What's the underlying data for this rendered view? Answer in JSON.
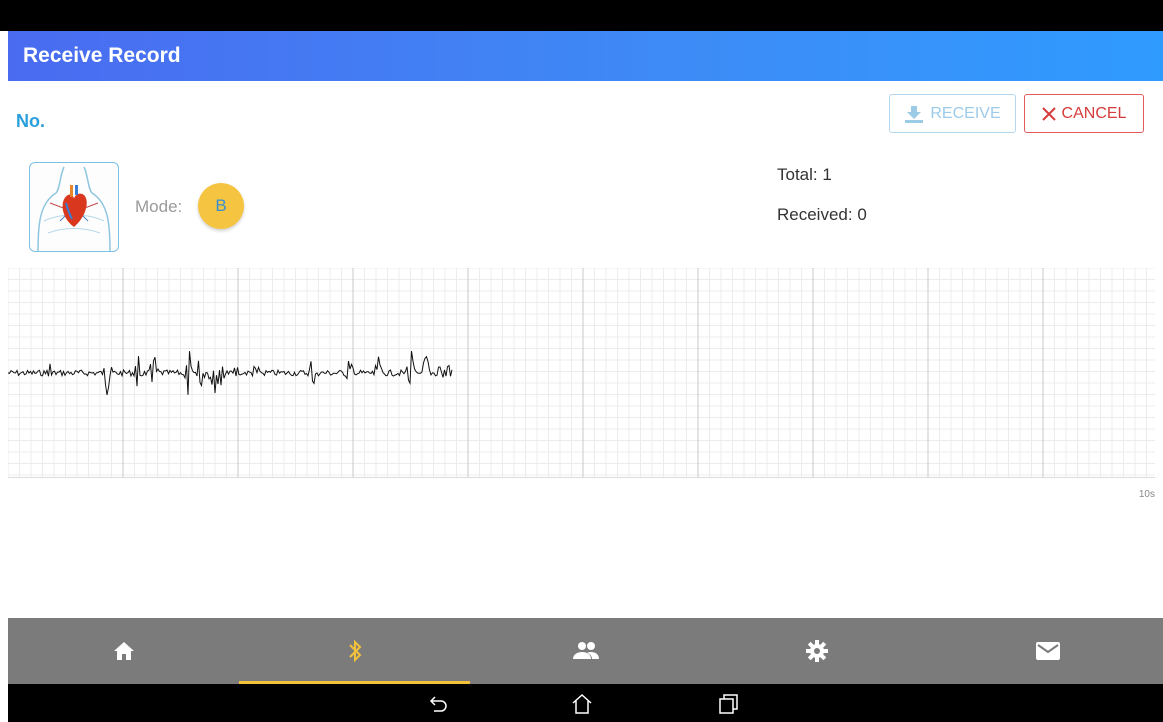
{
  "app_bar": {
    "title": "Receive Record"
  },
  "record": {
    "number_label": "No."
  },
  "actions": {
    "receive_label": "RECEIVE",
    "cancel_label": "CANCEL"
  },
  "info": {
    "mode_label": "Mode:",
    "mode_value": "B",
    "total": "Total: 1",
    "received": "Received: 0"
  },
  "chart": {
    "time_label": "10s"
  },
  "bottom_nav": {
    "items": [
      {
        "icon": "home-icon",
        "active": false
      },
      {
        "icon": "bluetooth-icon",
        "active": true
      },
      {
        "icon": "people-icon",
        "active": false
      },
      {
        "icon": "gear-icon",
        "active": false
      },
      {
        "icon": "mail-icon",
        "active": false
      }
    ]
  },
  "system_nav": {
    "icons": [
      "back-icon",
      "home-outline-icon",
      "recents-icon"
    ]
  },
  "colors": {
    "accent": "#2a9fdd",
    "nav_active": "#f4c13a",
    "cancel": "#d63b3b",
    "mode_badge": "#f5c542"
  }
}
